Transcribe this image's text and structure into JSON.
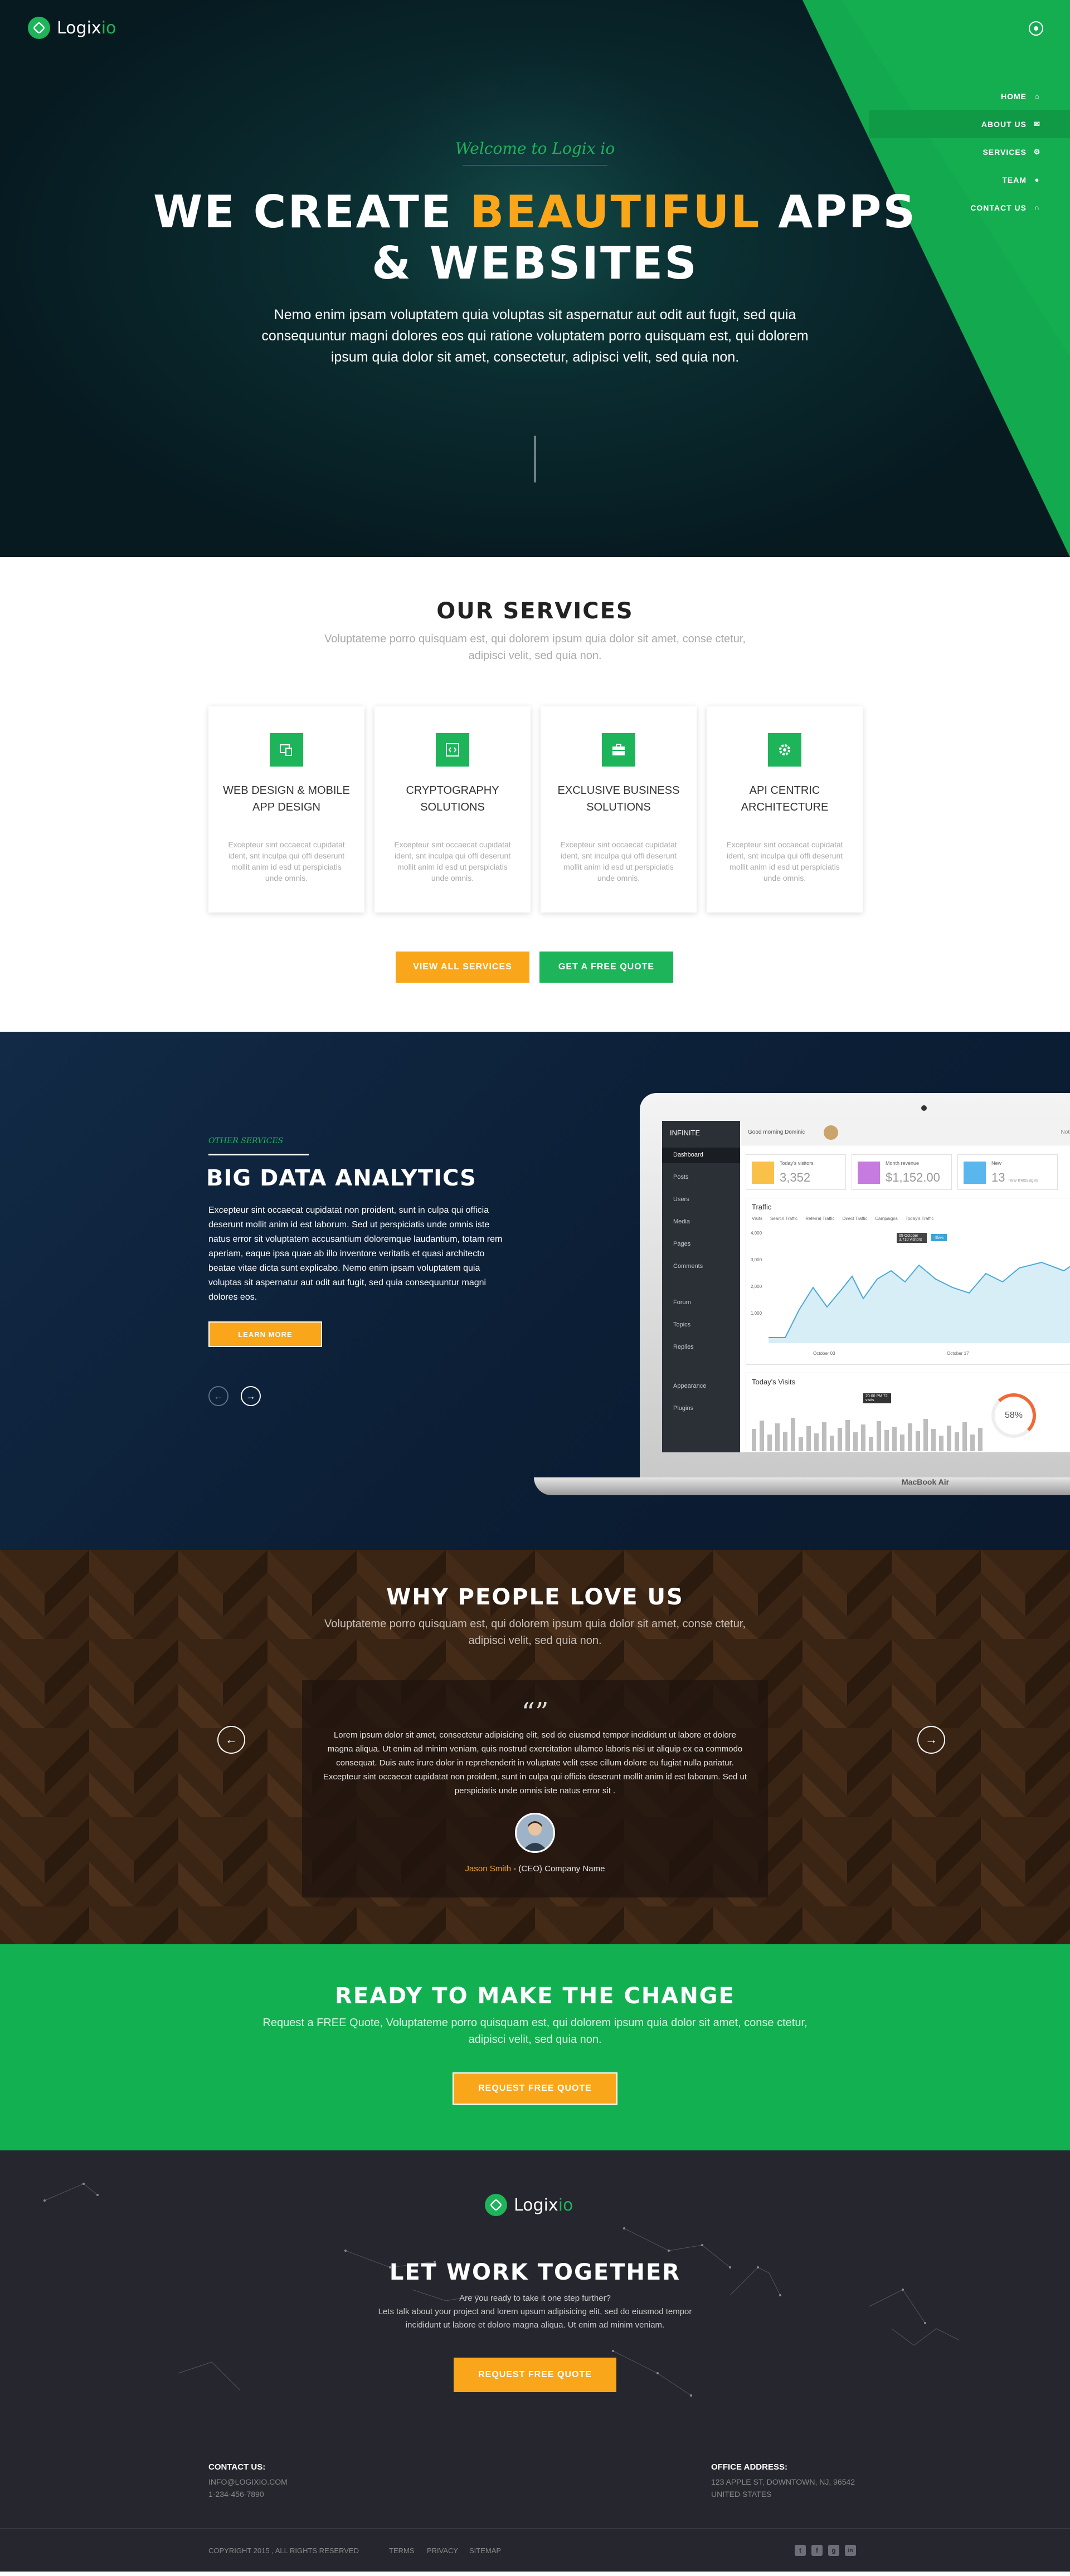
{
  "brand": {
    "name_main": "Logix",
    "name_accent": "io"
  },
  "colors": {
    "green": "#1db45a",
    "orange": "#f9a61a",
    "navy": "#0b1e35",
    "dark": "#26262e"
  },
  "nav": {
    "items": [
      {
        "label": "HOME",
        "icon": "home-icon"
      },
      {
        "label": "ABOUT US",
        "icon": "envelope-icon",
        "active": true
      },
      {
        "label": "SERVICES",
        "icon": "gear-icon"
      },
      {
        "label": "TEAM",
        "icon": "user-icon"
      },
      {
        "label": "CONTACT US",
        "icon": "headset-icon"
      }
    ]
  },
  "hero": {
    "welcome": "Welcome to Logix io",
    "title_pre": "WE CREATE ",
    "title_accent": "BEAUTIFUL",
    "title_post": " APPS",
    "title_line2": "& WEBSITES",
    "description": "Nemo enim ipsam voluptatem quia voluptas sit aspernatur aut odit aut fugit, sed quia consequuntur magni dolores eos qui ratione voluptatem porro quisquam est, qui dolorem ipsum quia dolor sit amet, consectetur, adipisci velit, sed quia non."
  },
  "services": {
    "title": "OUR SERVICES",
    "subtitle": "Voluptateme porro quisquam est, qui dolorem ipsum quia dolor sit amet, conse ctetur, adipisci velit, sed quia non.",
    "cards": [
      {
        "title": "WEB DESIGN & MOBILE APP DESIGN",
        "text": "Excepteur sint occaecat cupidatat ident, snt inculpa qui offi deserunt mollit anim id esd ut perspiciatis unde omnis.",
        "icon": "devices-icon"
      },
      {
        "title": "CRYPTOGRAPHY SOLUTIONS",
        "text": "Excepteur sint occaecat cupidatat ident, snt inculpa qui offi deserunt mollit anim id esd ut perspiciatis unde omnis.",
        "icon": "code-icon"
      },
      {
        "title": "EXCLUSIVE BUSINESS SOLUTIONS",
        "text": "Excepteur sint occaecat cupidatat ident, snt inculpa qui offi deserunt mollit anim id esd ut perspiciatis unde omnis.",
        "icon": "briefcase-icon"
      },
      {
        "title": "API CENTRIC ARCHITECTURE",
        "text": "Excepteur sint occaecat cupidatat ident, snt inculpa qui offi deserunt mollit anim id esd ut perspiciatis unde omnis.",
        "icon": "cog-icon"
      }
    ],
    "btn_all": "VIEW ALL SERVICES",
    "btn_quote": "GET A FREE QUOTE"
  },
  "analytics": {
    "eyebrow": "OTHER SERVICES",
    "title": "BIG DATA ANALYTICS",
    "text": "Excepteur sint occaecat cupidatat non proident, sunt in culpa qui officia deserunt mollit anim id est laborum. Sed ut perspiciatis unde omnis iste natus error sit voluptatem accusantium doloremque laudantium, totam rem aperiam, eaque ipsa quae ab illo inventore veritatis et quasi architecto beatae vitae dicta sunt explicabo. Nemo enim ipsam voluptatem quia voluptas sit aspernatur aut odit aut fugit, sed quia consequuntur magni dolores eos.",
    "learn_more": "LEARN MORE",
    "prev": "←",
    "next": "→",
    "dashboard": {
      "brand": "INFINITE",
      "user": "Good morning Dominic",
      "notifications": "Notifications",
      "menu": [
        "Dashboard",
        "Posts",
        "Users",
        "Media",
        "Pages",
        "Comments",
        "Forum",
        "Topics",
        "Replies",
        "Appearance",
        "Plugins"
      ],
      "stats": [
        {
          "label": "Today's visitors",
          "value": "3,352"
        },
        {
          "label": "Month revenue",
          "value": "$1,152.00"
        },
        {
          "label": "New",
          "value": "13",
          "suffix": "new messages"
        }
      ],
      "traffic_title": "Traffic",
      "legend": [
        "Visits",
        "Search Traffic",
        "Referral Traffic",
        "Direct Traffic",
        "Campaigns",
        "Today's Traffic"
      ],
      "ticks": [
        "4,000",
        "3,000",
        "2,000",
        "1,000"
      ],
      "x_labels": [
        "October 03",
        "October 17"
      ],
      "tooltip": "05 October 3,710 visitors",
      "badge": "45%",
      "visits_title": "Today's Visits",
      "gauge": "58",
      "mini_tooltip": "20:00 PM 72 visits",
      "laptop_label": "MacBook Air"
    }
  },
  "testimonials": {
    "title": "WHY PEOPLE LOVE US",
    "subtitle": "Voluptateme porro quisquam est, qui dolorem ipsum quia dolor sit amet, conse ctetur, adipisci velit, sed quia non.",
    "quote_mark": "“”",
    "text": "Lorem ipsum dolor sit amet, consectetur adipisicing elit, sed do eiusmod tempor incididunt ut labore et dolore magna aliqua. Ut enim ad minim veniam, quis nostrud exercitation ullamco laboris nisi ut aliquip ex ea commodo consequat. Duis aute irure dolor in reprehenderit in voluptate velit esse cillum dolore eu fugiat nulla pariatur. Excepteur sint occaecat cupidatat non proident, sunt in culpa qui officia deserunt mollit anim id est laborum. Sed ut perspiciatis unde omnis iste natus error sit .",
    "author": "Jason Smith",
    "sep": " - ",
    "role": "(CEO) Company Name",
    "prev": "←",
    "next": "→"
  },
  "cta": {
    "title": "READY TO MAKE THE CHANGE",
    "subtitle": "Request a FREE Quote, Voluptateme porro quisquam est, qui dolorem ipsum quia dolor sit amet, conse ctetur, adipisci velit, sed quia non.",
    "button": "REQUEST FREE QUOTE"
  },
  "footer": {
    "title": "LET WORK TOGETHER",
    "line1": "Are you ready to take it one step further?",
    "line2": "Lets talk about your project and lorem upsum adipisicing elit, sed do eiusmod tempor",
    "line3": "incididunt ut labore et dolore magna aliqua. Ut enim ad minim veniam.",
    "button": "REQUEST FREE QUOTE",
    "contact_title": "CONTACT US:",
    "email": "INFO@LOGIXIO.COM",
    "phone": "1-234-456-7890",
    "office_title": "OFFICE ADDRESS:",
    "address1": "123 APPLE ST, DOWNTOWN, NJ, 96542",
    "address2": "UNITED STATES",
    "copyright": "COPYRIGHT 2015 , ALL RIGHTS RESERVED",
    "links": [
      "TERMS",
      "PRIVACY",
      "SITEMAP"
    ],
    "social": [
      "twitter-icon",
      "facebook-icon",
      "google-plus-icon",
      "linkedin-icon"
    ],
    "social_glyphs": [
      "t",
      "f",
      "g",
      "in"
    ]
  }
}
